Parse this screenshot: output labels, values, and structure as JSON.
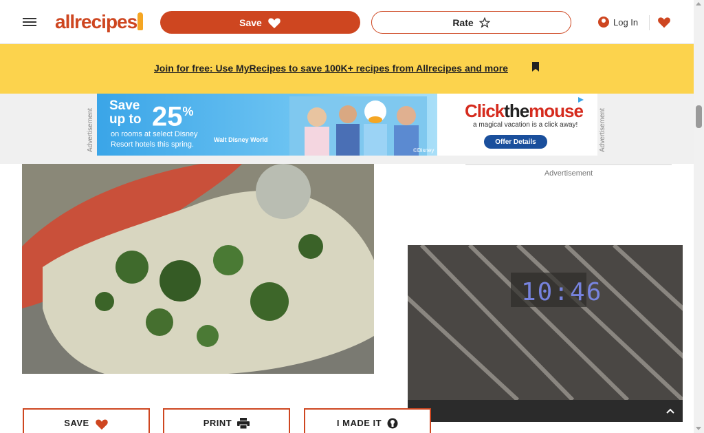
{
  "header": {
    "logo_text": "allrecipes",
    "save_label": "Save",
    "rate_label": "Rate",
    "login_label": "Log In"
  },
  "banner": {
    "link_text": "Join for free: Use MyRecipes to save 100K+ recipes from Allrecipes and more"
  },
  "top_ad": {
    "side_label": "Advertisement",
    "save_text": "Save up to",
    "percent": "25",
    "percent_sign": "%",
    "subline": "on rooms at select Disney Resort hotels this spring.",
    "resort_brand": "Walt Disney World",
    "copyright": "©Disney",
    "brand_name_a": "Click",
    "brand_name_b": "the",
    "brand_name_c": "mouse",
    "tagline": "a magical vacation is a click away!",
    "cta": "Offer Details"
  },
  "side_ad": {
    "label": "Advertisement"
  },
  "video": {
    "clock_display": "10:46"
  },
  "actions": {
    "save_label": "SAVE",
    "print_label": "PRINT",
    "made_it_label": "I MADE IT"
  },
  "colors": {
    "brand": "#ce4620",
    "banner": "#fcd34d",
    "ad_blue": "#3aa5e8"
  },
  "icons": {
    "menu": "hamburger-icon",
    "save": "heart-icon",
    "rate": "star-icon",
    "login": "user-icon",
    "print": "printer-icon",
    "made_it": "chef-hat-icon",
    "collapse": "chevron-up-icon"
  }
}
